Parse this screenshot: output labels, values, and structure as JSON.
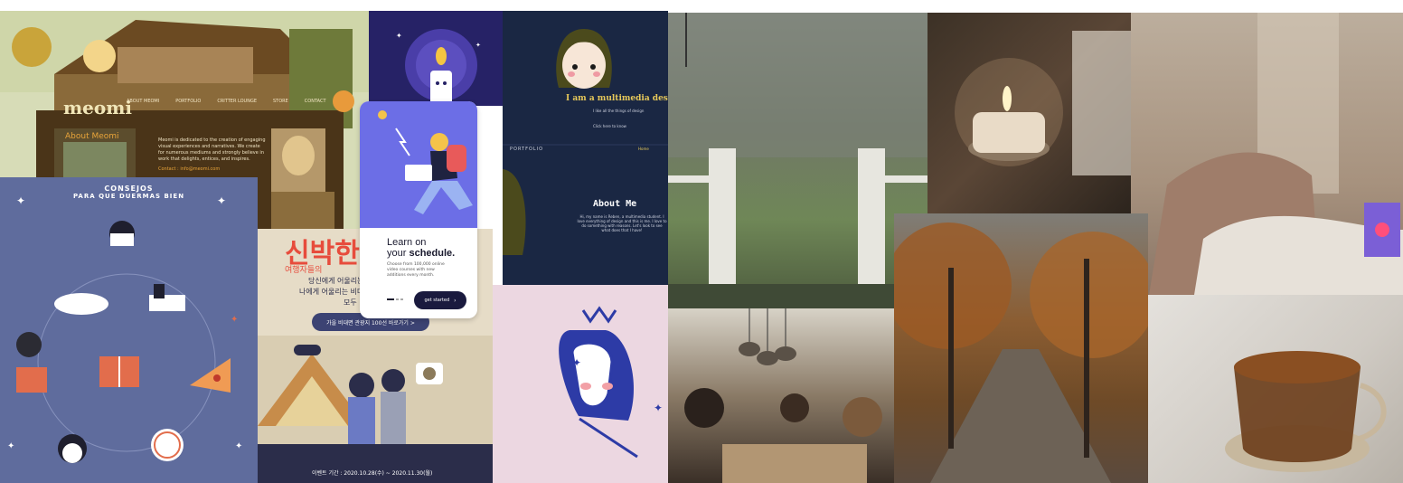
{
  "meomi": {
    "logo": "meomi",
    "nav": [
      "ABOUT MEOMI",
      "PORTFOLIO",
      "CRITTER LOUNGE",
      "STORE",
      "CONTACT"
    ],
    "about_title": "About Meomi",
    "about_text": "Meomi is dedicated to the creation of engaging visual experiences and narratives. We create for numerous mediums and strongly believe in work that delights, entices, and inspires.",
    "contact": "Contact : info@meomi.com"
  },
  "consejos": {
    "title_line1": "CONSEJOS",
    "title_line2": "PARA QUE DUERMAS BIEN"
  },
  "learn": {
    "title_line1": "Learn on",
    "title_line2_a": "your ",
    "title_line2_b": "schedule.",
    "body": "Choose from 100,000 online video courses with new additions every month.",
    "cta": "get started"
  },
  "designer": {
    "headline": "I am a multimedia designer",
    "sub": "I like all the things of design",
    "link": "Click here to know",
    "portfolio": "PORTFOLIO",
    "home": "Home",
    "about_title": "About Me",
    "about_text": "Hi, my name is Reben, a multimedia student. I love everything of design and this is me. I love to do something with reasons. Let's look to see what does that I have!"
  },
  "korean": {
    "title": "신박한",
    "subtitle": "여행자들의",
    "line1": "당신에게 어울리는 비",
    "line2": "나에게 어울리는 비대면",
    "line3": "모두",
    "button": "가을 비대면 관광지 100선 바로가기 >",
    "dates": "이벤트 기간 : 2020.10.28(수) ~ 2020.11.30(월)"
  },
  "colors": {
    "meomi_bg": "#d7dcb7",
    "consejos_bg": "#5f6c9d",
    "learn_bg": "#6c6ee6",
    "designer_bg": "#1a2743",
    "korean_bg": "#e6dcc7",
    "pink_bg": "#ecd7e1",
    "face_blue": "#2d3ba6"
  },
  "photos": [
    "rainy-porch",
    "candle",
    "bedroom-laptop",
    "autumn-road",
    "dinner-friends",
    "tea-cup"
  ]
}
